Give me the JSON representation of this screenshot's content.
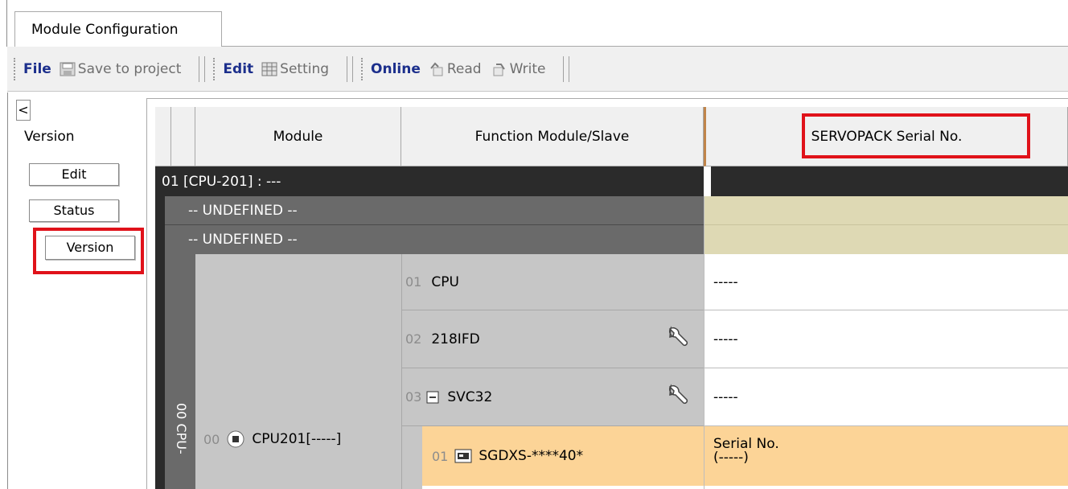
{
  "tab": {
    "label": "Module Configuration"
  },
  "toolbar": {
    "file": "File",
    "save": "Save to project",
    "edit": "Edit",
    "setting": "Setting",
    "online": "Online",
    "read": "Read",
    "write": "Write"
  },
  "sidebar": {
    "collapse": "<",
    "title": "Version",
    "buttons": [
      "Edit",
      "Status",
      "Version"
    ]
  },
  "grid": {
    "headers": {
      "module": "Module",
      "function": "Function Module/Slave",
      "serial": "SERVOPACK Serial No."
    },
    "cpu_row": "01  [CPU-201] : ---",
    "undefined_1": "-- UNDEFINED --",
    "undefined_2": "-- UNDEFINED --",
    "vertical_label": "00  CPU-",
    "module_num": "00",
    "module_name": "CPU201[-----]",
    "functions": [
      {
        "num": "01",
        "name": "CPU",
        "serial": "-----"
      },
      {
        "num": "02",
        "name": "218IFD",
        "serial": "-----"
      },
      {
        "num": "03",
        "name": "SVC32",
        "serial": "-----"
      }
    ],
    "slave": {
      "num": "01",
      "name": "SGDXS-****40*",
      "serial_line1": "Serial No.",
      "serial_line2": "(-----)"
    }
  }
}
